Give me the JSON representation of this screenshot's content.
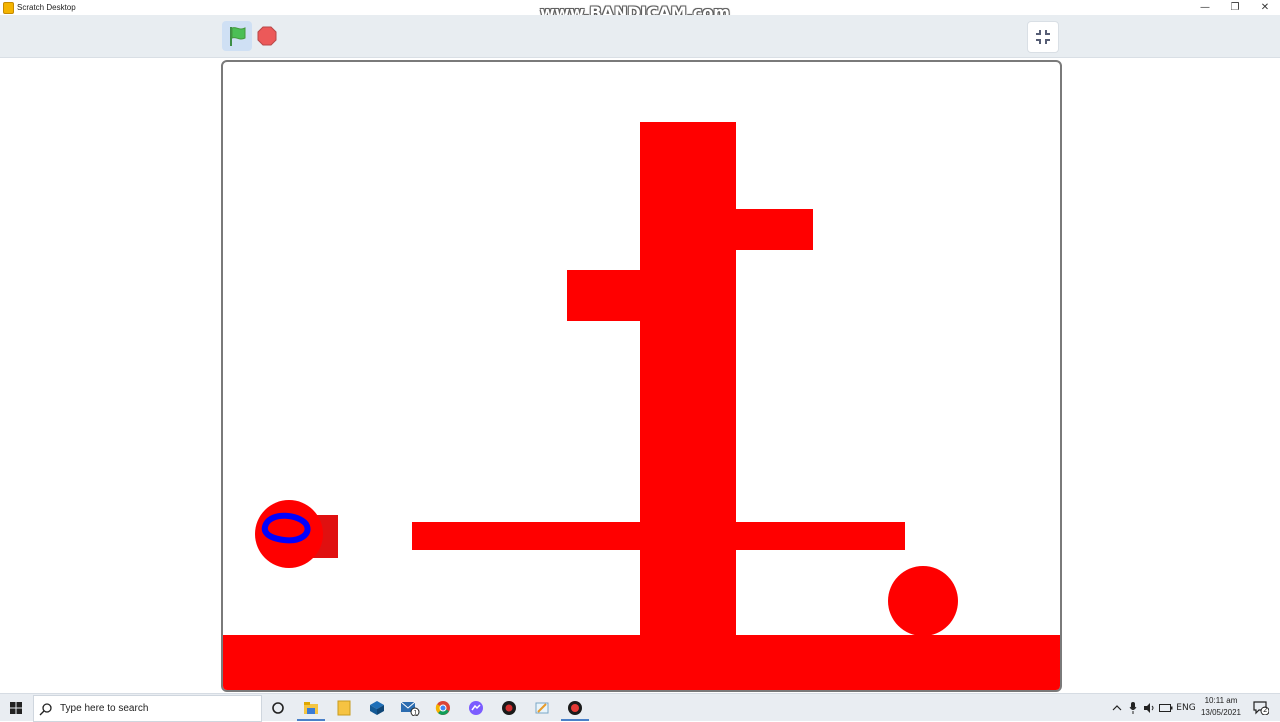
{
  "window": {
    "title": "Scratch Desktop",
    "minimize_glyph": "—",
    "restore_glyph": "❐",
    "close_glyph": "✕"
  },
  "watermark": "www.BANDICAM.com",
  "toolbar": {
    "green_flag_icon": "green-flag-icon",
    "stop_icon": "stop-icon",
    "fullscreen_icon": "unfullscreen-icon",
    "colors": {
      "flag": "#4cbf56",
      "stop": "#ec5959",
      "flag_active_bg": "#cfe0f4"
    }
  },
  "stage": {
    "background": "#ffffff",
    "shape_color": "#ff0000",
    "sprites": [
      "player-ball",
      "goal-ball"
    ],
    "player_marker_color": "#0000ff"
  },
  "taskbar": {
    "search_placeholder": "Type here to search",
    "tray_language": "ENG",
    "clock_time": "10:11 am",
    "clock_date": "13/05/2021",
    "notification_count": "2",
    "pinned_apps": [
      "cortana-icon",
      "file-explorer-icon",
      "sticky-notes-icon",
      "3d-builder-icon",
      "mail-icon",
      "chrome-icon",
      "messenger-icon",
      "app-icon",
      "paint-icon",
      "bandicam-icon"
    ]
  }
}
